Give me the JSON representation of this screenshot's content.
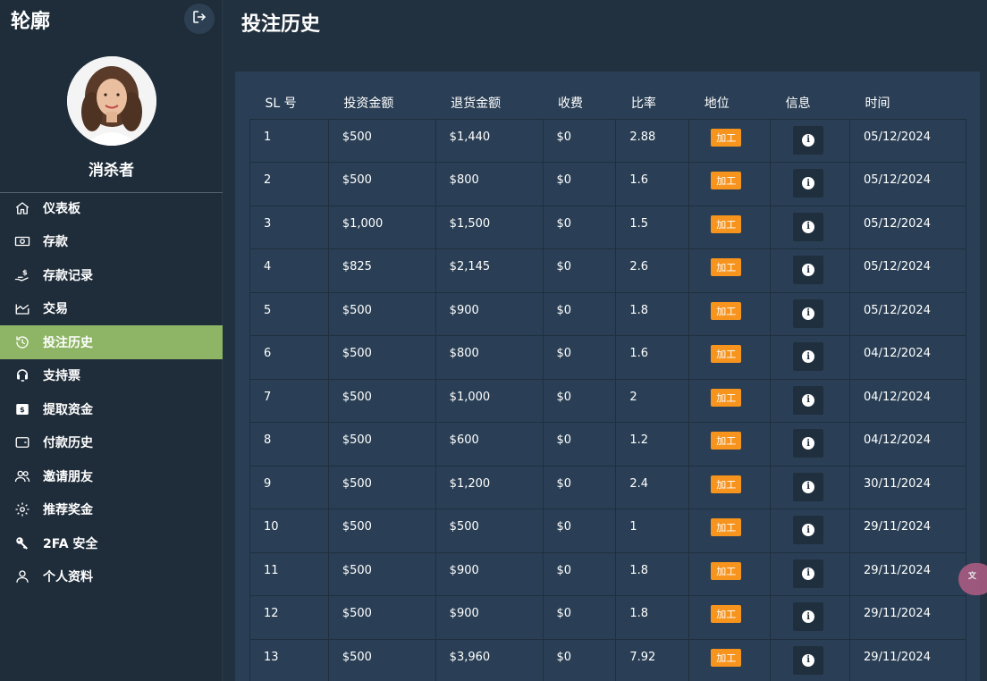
{
  "sidebar": {
    "brand": "轮廓",
    "username": "消杀者",
    "items": [
      {
        "label": "仪表板",
        "icon": "home-icon"
      },
      {
        "label": "存款",
        "icon": "banknote-icon"
      },
      {
        "label": "存款记录",
        "icon": "hand-money-icon"
      },
      {
        "label": "交易",
        "icon": "chart-trend-icon"
      },
      {
        "label": "投注历史",
        "icon": "history-icon"
      },
      {
        "label": "支持票",
        "icon": "headset-icon"
      },
      {
        "label": "提取资金",
        "icon": "wallet-dollar-icon"
      },
      {
        "label": "付款历史",
        "icon": "wallet-icon"
      },
      {
        "label": "邀请朋友",
        "icon": "users-icon"
      },
      {
        "label": "推荐奖金",
        "icon": "gear-icon"
      },
      {
        "label": "2FA 安全",
        "icon": "key-icon"
      },
      {
        "label": "个人资料",
        "icon": "user-icon"
      }
    ],
    "active_index": 4
  },
  "header": {
    "title": "投注历史"
  },
  "table": {
    "headers": [
      "SL 号",
      "投资金额",
      "退货金额",
      "收费",
      "比率",
      "地位",
      "信息",
      "时间"
    ],
    "rows": [
      {
        "sl": "1",
        "invest": "$500",
        "return": "$1,440",
        "fee": "$0",
        "rate": "2.88",
        "status": "加工",
        "time": "05/12/2024"
      },
      {
        "sl": "2",
        "invest": "$500",
        "return": "$800",
        "fee": "$0",
        "rate": "1.6",
        "status": "加工",
        "time": "05/12/2024"
      },
      {
        "sl": "3",
        "invest": "$1,000",
        "return": "$1,500",
        "fee": "$0",
        "rate": "1.5",
        "status": "加工",
        "time": "05/12/2024"
      },
      {
        "sl": "4",
        "invest": "$825",
        "return": "$2,145",
        "fee": "$0",
        "rate": "2.6",
        "status": "加工",
        "time": "05/12/2024"
      },
      {
        "sl": "5",
        "invest": "$500",
        "return": "$900",
        "fee": "$0",
        "rate": "1.8",
        "status": "加工",
        "time": "05/12/2024"
      },
      {
        "sl": "6",
        "invest": "$500",
        "return": "$800",
        "fee": "$0",
        "rate": "1.6",
        "status": "加工",
        "time": "04/12/2024"
      },
      {
        "sl": "7",
        "invest": "$500",
        "return": "$1,000",
        "fee": "$0",
        "rate": "2",
        "status": "加工",
        "time": "04/12/2024"
      },
      {
        "sl": "8",
        "invest": "$500",
        "return": "$600",
        "fee": "$0",
        "rate": "1.2",
        "status": "加工",
        "time": "04/12/2024"
      },
      {
        "sl": "9",
        "invest": "$500",
        "return": "$1,200",
        "fee": "$0",
        "rate": "2.4",
        "status": "加工",
        "time": "30/11/2024"
      },
      {
        "sl": "10",
        "invest": "$500",
        "return": "$500",
        "fee": "$0",
        "rate": "1",
        "status": "加工",
        "time": "29/11/2024"
      },
      {
        "sl": "11",
        "invest": "$500",
        "return": "$900",
        "fee": "$0",
        "rate": "1.8",
        "status": "加工",
        "time": "29/11/2024"
      },
      {
        "sl": "12",
        "invest": "$500",
        "return": "$900",
        "fee": "$0",
        "rate": "1.8",
        "status": "加工",
        "time": "29/11/2024"
      },
      {
        "sl": "13",
        "invest": "$500",
        "return": "$3,960",
        "fee": "$0",
        "rate": "7.92",
        "status": "加工",
        "time": "29/11/2024"
      }
    ]
  },
  "colors": {
    "sidebar_bg": "#1f2d3a",
    "panel_bg": "#2a3f55",
    "active_menu": "#8db565",
    "status_badge": "#f7941d"
  }
}
